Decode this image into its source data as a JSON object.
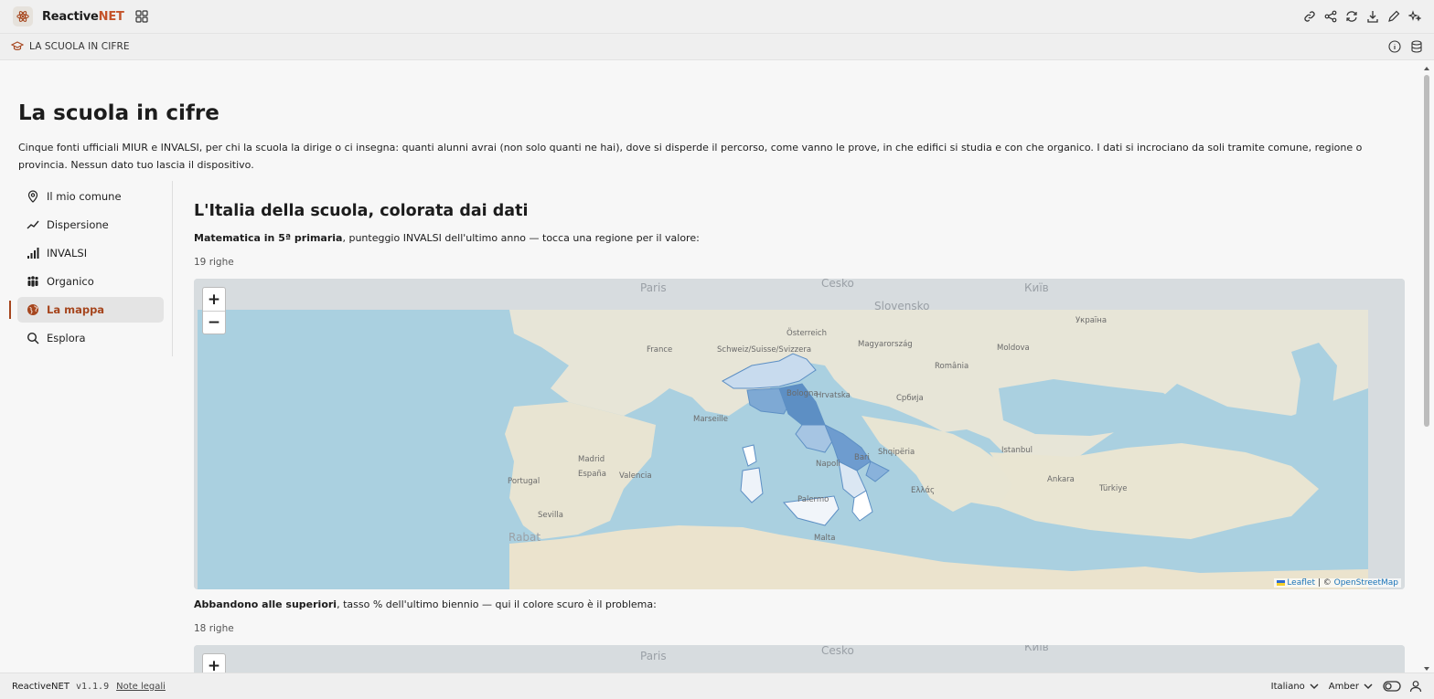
{
  "app": {
    "name_main": "Reactive",
    "name_accent": "NET"
  },
  "breadcrumb": "LA SCUOLA IN CIFRE",
  "page": {
    "title": "La scuola in cifre",
    "intro": "Cinque fonti ufficiali MIUR e INVALSI, per chi la scuola la dirige o ci insegna: quanti alunni avrai (non solo quanti ne hai), dove si disperde il percorso, come vanno le prove, in che edifici si studia e con che organico. I dati si incrociano da soli tramite comune, regione o provincia. Nessun dato tuo lascia il dispositivo."
  },
  "sidebar": {
    "items": [
      {
        "label": "Il mio comune",
        "icon": "map-pin-icon"
      },
      {
        "label": "Dispersione",
        "icon": "trend-line-icon"
      },
      {
        "label": "INVALSI",
        "icon": "bar-signal-icon"
      },
      {
        "label": "Organico",
        "icon": "people-icon"
      },
      {
        "label": "La mappa",
        "icon": "globe-icon",
        "active": true
      },
      {
        "label": "Esplora",
        "icon": "search-icon"
      }
    ]
  },
  "section": {
    "title": "L'Italia della scuola, colorata dai dati"
  },
  "map1": {
    "desc_bold": "Matematica in 5ª primaria",
    "desc_rest": ", punteggio INVALSI dell'ultimo anno — tocca una regione per il valore:",
    "rows": "19 righe"
  },
  "map2": {
    "desc_bold": "Abbandono alle superiori",
    "desc_rest": ", tasso % dell'ultimo biennio — qui il colore scuro è il problema:",
    "rows": "18 righe"
  },
  "map_labels": {
    "zoom_in": "+",
    "zoom_out": "−",
    "attrib_leaflet": "Leaflet",
    "attrib_sep": " | © ",
    "attrib_osm": "OpenStreetMap",
    "places": [
      "Paris",
      "Česko",
      "Київ",
      "Schweiz/Suisse/Svizzera",
      "Österreich",
      "Magyarország",
      "România",
      "Moldova",
      "France",
      "Portugal",
      "España",
      "Hrvatska",
      "Србија",
      "Shqipëria",
      "Ελλάς",
      "Türkiye",
      "Україна",
      "Slovensko",
      "Bologna",
      "Napoli",
      "Bari",
      "Palermo",
      "Marseille",
      "Madrid",
      "Valencia",
      "Sevilla",
      "Malta",
      "Rabat",
      "Istanbul",
      "Ankara"
    ]
  },
  "footer": {
    "app_name": "ReactiveNET",
    "version": "v1.1.9",
    "legal": "Note legali",
    "language": "Italiano",
    "theme": "Amber"
  },
  "colors": {
    "accent": "#a6461e",
    "brand_accent": "#c4532a",
    "sea": "#a9d0df",
    "region_dark": "#5d8fc4",
    "region_light": "#dbe7f3"
  }
}
